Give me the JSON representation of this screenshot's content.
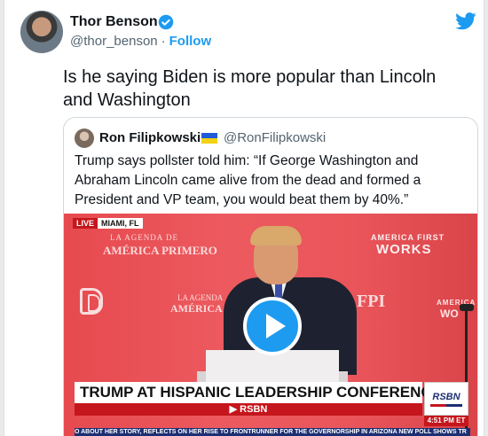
{
  "tweet": {
    "author": {
      "name": "Thor Benson",
      "handle": "@thor_benson",
      "follow_label": "Follow"
    },
    "text": "Is he saying Biden is more popular than Lincoln and Washington"
  },
  "quoted_tweet": {
    "author": {
      "name": "Ron Filipkowski",
      "handle": "@RonFilipkowski"
    },
    "text": "Trump says pollster told him: “If George Washington and Abraham Lincoln came alive from the dead and formed a President and VP team, you would beat them by 40%.”",
    "video": {
      "live_label": "LIVE",
      "location": "MIAMI, FL",
      "background_text": {
        "agenda_small_1": "LA AGENDA DE",
        "agenda_large_1": "AMÉRICA PRIMERO",
        "agenda_small_2": "LA AGENDA",
        "agenda_large_2": "AMÉRICA P",
        "fpi": "FPI",
        "af_small": "AMERICA FIRST",
        "af_large": "WORKS",
        "am_small": "AMERICA",
        "am_large": "WO"
      },
      "headline": "TRUMP AT HISPANIC LEADERSHIP CONFERENCE",
      "channel": "RSBN",
      "channel_bar": "▶ RSBN",
      "time": "4:51 PM ET",
      "ticker": "O ABOUT HER STORY, REFLECTS ON HER RISE TO FRONTRUNNER FOR THE GOVERNORSHIP IN ARIZONA    NEW POLL SHOWS TR"
    }
  },
  "colors": {
    "accent": "#1d9bf0",
    "video_red": "#e64a4f",
    "ticker_blue": "#1c2f73"
  }
}
